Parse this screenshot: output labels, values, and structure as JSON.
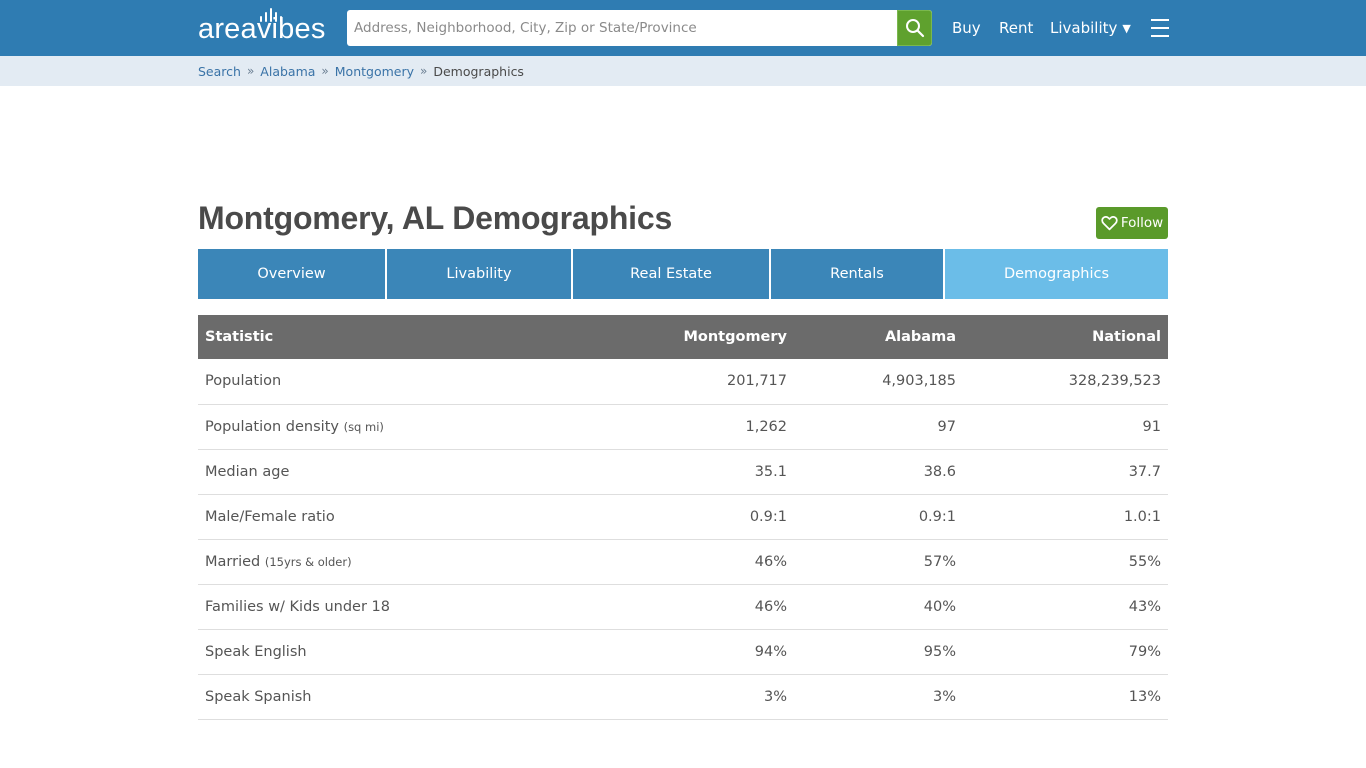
{
  "header": {
    "logo_text": "areavibes",
    "search": {
      "placeholder": "Address, Neighborhood, City, Zip or State/Province",
      "value": ""
    },
    "search_button_icon": "search-icon",
    "nav": {
      "buy": "Buy",
      "rent": "Rent",
      "livability": "Livability",
      "livability_caret": "▼"
    },
    "menu_icon": "hamburger-icon"
  },
  "breadcrumb": {
    "items": [
      {
        "label": "Search"
      },
      {
        "label": "Alabama"
      },
      {
        "label": "Montgomery"
      }
    ],
    "separator": "»",
    "current": "Demographics"
  },
  "page": {
    "title": "Montgomery, AL Demographics",
    "follow_label": "Follow"
  },
  "tabs": [
    {
      "label": "Overview",
      "active": false
    },
    {
      "label": "Livability",
      "active": false
    },
    {
      "label": "Real Estate",
      "active": false
    },
    {
      "label": "Rentals",
      "active": false
    },
    {
      "label": "Demographics",
      "active": true
    }
  ],
  "table": {
    "headers": [
      "Statistic",
      "Montgomery",
      "Alabama",
      "National"
    ],
    "rows": [
      {
        "label": "Population",
        "note": "",
        "values": [
          "201,717",
          "4,903,185",
          "328,239,523"
        ]
      },
      {
        "label": "Population density",
        "note": "(sq mi)",
        "values": [
          "1,262",
          "97",
          "91"
        ]
      },
      {
        "label": "Median age",
        "note": "",
        "values": [
          "35.1",
          "38.6",
          "37.7"
        ]
      },
      {
        "label": "Male/Female ratio",
        "note": "",
        "values": [
          "0.9:1",
          "0.9:1",
          "1.0:1"
        ]
      },
      {
        "label": "Married",
        "note": "(15yrs & older)",
        "values": [
          "46%",
          "57%",
          "55%"
        ]
      },
      {
        "label": "Families w/ Kids under 18",
        "note": "",
        "values": [
          "46%",
          "40%",
          "43%"
        ]
      },
      {
        "label": "Speak English",
        "note": "",
        "values": [
          "94%",
          "95%",
          "79%"
        ]
      },
      {
        "label": "Speak Spanish",
        "note": "",
        "values": [
          "3%",
          "3%",
          "13%"
        ]
      }
    ]
  },
  "colors": {
    "header_blue": "#2f7cb2",
    "breadcrumb_bg": "#e3ebf3",
    "tab_blue": "#3b86b8",
    "tab_active": "#6bbde8",
    "table_header": "#6b6b6b",
    "green": "#5a9a2a"
  }
}
